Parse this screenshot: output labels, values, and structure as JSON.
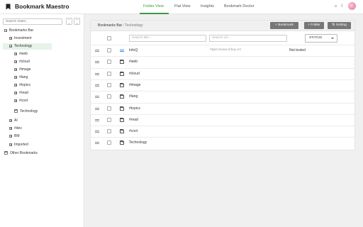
{
  "app": {
    "title": "Bookmark Maestro"
  },
  "nav": {
    "tabs": [
      {
        "label": "Folder View",
        "active": true
      },
      {
        "label": "Flat View",
        "active": false
      },
      {
        "label": "Insights",
        "active": false
      },
      {
        "label": "Bookmark Doctor",
        "active": false
      }
    ]
  },
  "header_actions": {
    "theme_icon": "sun-icon",
    "dark_icon": "moon-icon"
  },
  "sidebar": {
    "search_placeholder": "Search folder...",
    "sort_asc": "↑↓",
    "tree": [
      {
        "label": "Bookmarks Bar",
        "expander": "minus"
      },
      {
        "label": "Investment",
        "expander": "plus"
      },
      {
        "label": "Technology",
        "expander": "minus",
        "selected": true
      },
      {
        "label": "#web",
        "expander": "plus"
      },
      {
        "label": "#cloud",
        "expander": "plus"
      },
      {
        "label": "#image",
        "expander": "plus"
      },
      {
        "label": "#lang",
        "expander": "plus"
      },
      {
        "label": "#topics",
        "expander": "plus"
      },
      {
        "label": "#read",
        "expander": "plus"
      },
      {
        "label": "#cool",
        "expander": "plus"
      },
      {
        "label": "Technology",
        "expander": "folder"
      },
      {
        "label": "AI",
        "expander": "plus"
      },
      {
        "label": "#dev",
        "expander": "plus"
      },
      {
        "label": "BM",
        "expander": "plus"
      },
      {
        "label": "Imported",
        "expander": "plus"
      },
      {
        "label": "Other Bookmarks",
        "expander": "folder"
      }
    ]
  },
  "main": {
    "breadcrumb": {
      "root": "Bookmarks Bar",
      "separator": "/",
      "current": "Technology"
    },
    "buttons": {
      "add_bookmark": "+ Bookmark",
      "add_folder": "+ Folder",
      "sorting": "⇅ Sorting"
    },
    "filters": {
      "title_placeholder": "Search title...",
      "url_placeholder": "Search url...",
      "status_label": "STATUS"
    },
    "rows": [
      {
        "type": "bookmark",
        "name": "InfoQ",
        "url": "https://www.infoq.cn/",
        "status": "Not tested"
      },
      {
        "type": "folder",
        "name": "#web",
        "url": "",
        "status": ""
      },
      {
        "type": "folder",
        "name": "#cloud",
        "url": "",
        "status": ""
      },
      {
        "type": "folder",
        "name": "#image",
        "url": "",
        "status": ""
      },
      {
        "type": "folder",
        "name": "#lang",
        "url": "",
        "status": ""
      },
      {
        "type": "folder",
        "name": "#topics",
        "url": "",
        "status": ""
      },
      {
        "type": "folder",
        "name": "#read",
        "url": "",
        "status": ""
      },
      {
        "type": "folder",
        "name": "#cool",
        "url": "",
        "status": ""
      },
      {
        "type": "folder",
        "name": "Technology",
        "url": "",
        "status": ""
      }
    ]
  },
  "colors": {
    "accent": "#3e9a44",
    "button": "#777777",
    "selected_bg": "#e7f3e8"
  }
}
